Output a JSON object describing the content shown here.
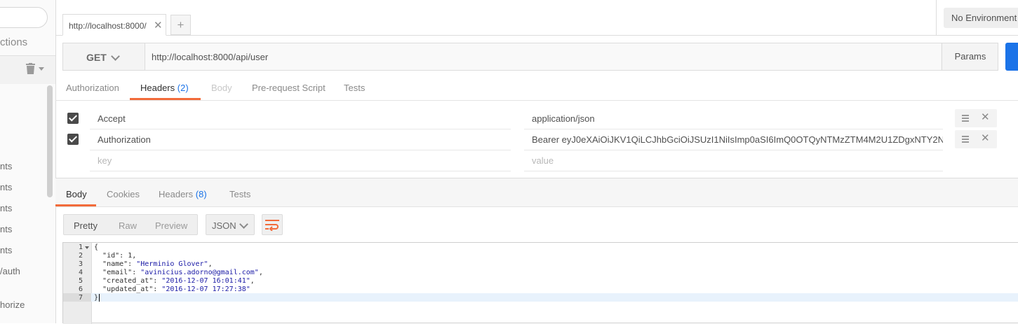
{
  "sidebar": {
    "collections_label": "ctions",
    "items": [
      {
        "label": "nts"
      },
      {
        "label": "nts"
      },
      {
        "label": "nts"
      },
      {
        "label": "nts"
      },
      {
        "label": "nts"
      },
      {
        "label": "/auth"
      },
      {
        "label": "horize"
      }
    ]
  },
  "tabs": {
    "open_tab_label": "http://localhost:8000/",
    "close_glyph": "✕",
    "new_tab_glyph": "+"
  },
  "environment": {
    "label": "No Environment"
  },
  "request": {
    "method": "GET",
    "url": "http://localhost:8000/api/user",
    "params_label": "Params"
  },
  "request_tabs": {
    "authorization": "Authorization",
    "headers": "Headers",
    "headers_count": "(2)",
    "body": "Body",
    "prerequest": "Pre-request Script",
    "tests": "Tests"
  },
  "headers": {
    "rows": [
      {
        "key": "Accept",
        "value": "application/json",
        "enabled": true
      },
      {
        "key": "Authorization",
        "value": "Bearer eyJ0eXAiOiJKV1QiLCJhbGciOiJSUzI1NiIsImp0aSI6ImQ0OTQyNTMzZTM4M2U1ZDgxNTY2NzQ3M",
        "enabled": true
      }
    ],
    "key_placeholder": "key",
    "value_placeholder": "value",
    "remove_glyph": "✕"
  },
  "response_tabs": {
    "body": "Body",
    "cookies": "Cookies",
    "headers": "Headers",
    "headers_count": "(8)",
    "tests": "Tests"
  },
  "format": {
    "pretty": "Pretty",
    "raw": "Raw",
    "preview": "Preview",
    "language": "JSON"
  },
  "response_body": {
    "line_numbers": [
      "1",
      "2",
      "3",
      "4",
      "5",
      "6",
      "7"
    ],
    "open_brace": "{",
    "close_brace": "}",
    "fields": [
      {
        "key": "\"id\"",
        "value": "1",
        "comma": ","
      },
      {
        "key": "\"name\"",
        "value": "\"Herminio Glover\"",
        "comma": ","
      },
      {
        "key": "\"email\"",
        "value": "\"avinicius.adorno@gmail.com\"",
        "comma": ","
      },
      {
        "key": "\"created_at\"",
        "value": "\"2016-12-07 16:01:41\"",
        "comma": ","
      },
      {
        "key": "\"updated_at\"",
        "value": "\"2016-12-07 17:27:38\"",
        "comma": ""
      }
    ]
  },
  "colors": {
    "accent_orange": "#f26b3a",
    "send_blue": "#1b73e8",
    "json_string": "#1a1aa6"
  }
}
